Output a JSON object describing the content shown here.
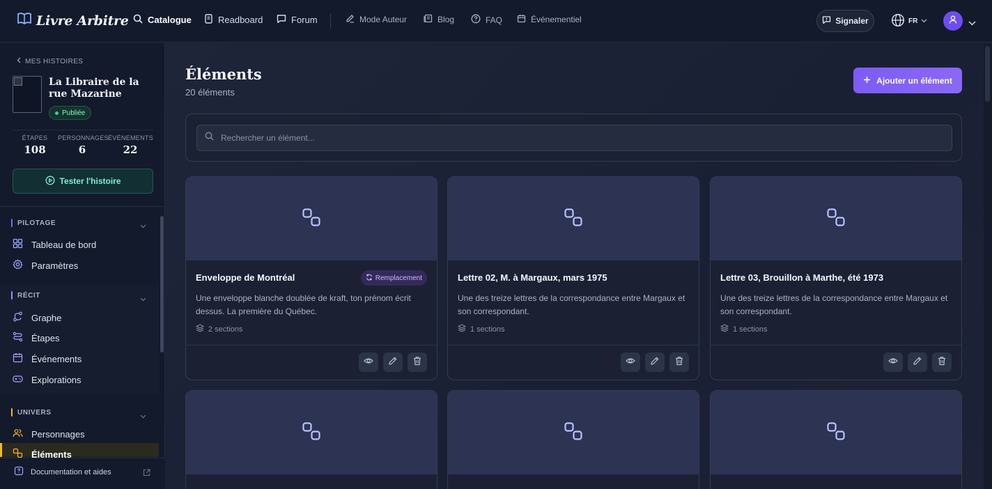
{
  "brand": {
    "name": "Livre Arbitre"
  },
  "nav": {
    "catalogue": "Catalogue",
    "readboard": "Readboard",
    "forum": "Forum",
    "mode_auteur": "Mode Auteur",
    "blog": "Blog",
    "faq": "FAQ",
    "evenementiel": "Événementiel",
    "signaler": "Signaler",
    "lang": "FR"
  },
  "sidebar": {
    "back_label": "MES HISTOIRES",
    "story_title": "La Libraire de la rue Mazarine",
    "status": "Publiée",
    "stats": [
      {
        "label": "ÉTAPES",
        "value": "108"
      },
      {
        "label": "PERSONNAGES",
        "value": "6"
      },
      {
        "label": "ÉVÉNEMENTS",
        "value": "22"
      }
    ],
    "test_button": "Tester l'histoire",
    "sections": {
      "pilotage": {
        "title": "PILOTAGE",
        "items": [
          "Tableau de bord",
          "Paramètres"
        ]
      },
      "recit": {
        "title": "RÉCIT",
        "items": [
          "Graphe",
          "Étapes",
          "Événements",
          "Explorations"
        ]
      },
      "univers": {
        "title": "UNIVERS",
        "items": [
          "Personnages",
          "Éléments"
        ]
      }
    },
    "doc_link": "Documentation et aides",
    "colors": {
      "pilotage": "#7c6cf5",
      "recit": "#a78bfa",
      "univers": "#f5b82e"
    }
  },
  "main": {
    "title": "Éléments",
    "count": "20 éléments",
    "add_button": "Ajouter un élément",
    "search_placeholder": "Rechercher un élément...",
    "cards": [
      {
        "title": "Enveloppe de Montréal",
        "badge": "Remplacement",
        "description": "Une enveloppe blanche doublée de kraft, ton prénom écrit dessus. La première du Québec.",
        "sections": "2 sections"
      },
      {
        "title": "Lettre 02, M. à Margaux, mars 1975",
        "badge": "",
        "description": "Une des treize lettres de la correspondance entre Margaux et son correspondant.",
        "sections": "1 sections"
      },
      {
        "title": "Lettre 03, Brouillon à Marthe, été 1973",
        "badge": "",
        "description": "Une des treize lettres de la correspondance entre Margaux et son correspondant.",
        "sections": "1 sections"
      }
    ]
  }
}
